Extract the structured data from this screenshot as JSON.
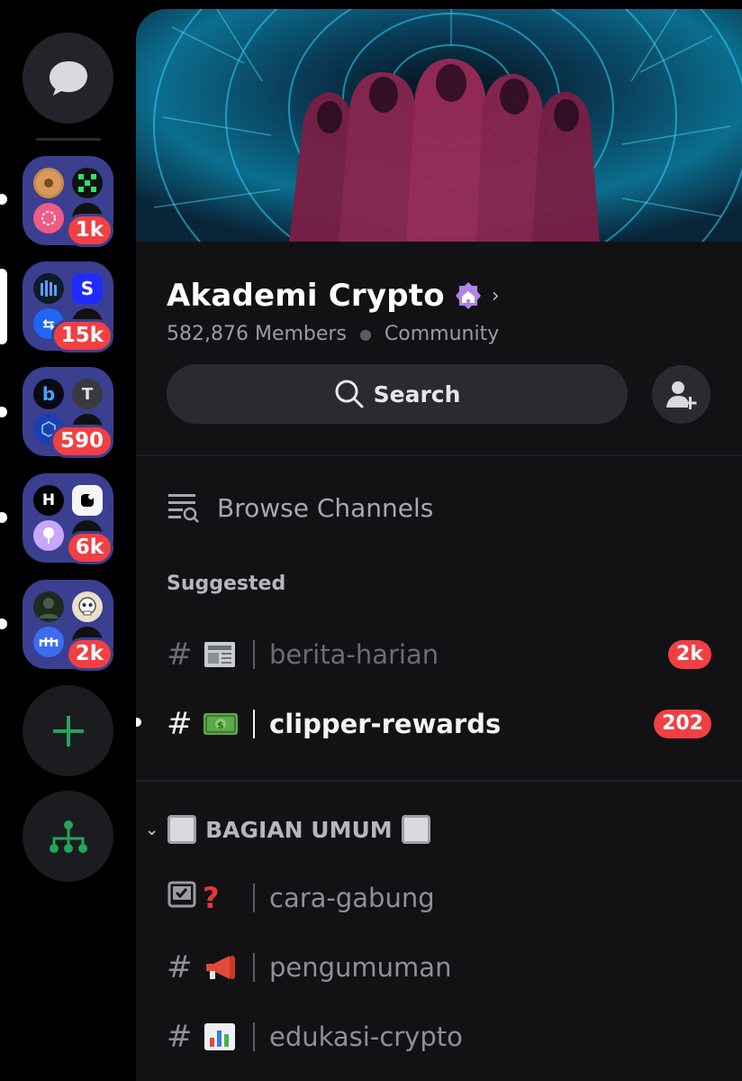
{
  "rail": {
    "dm_icon": "chat-bubble-icon",
    "folders": [
      {
        "badge": "1k",
        "icons": [
          "donut-icon",
          "grid-logo-icon",
          "pink-dots-icon",
          "black-logo-icon"
        ]
      },
      {
        "badge": "15k",
        "icons": [
          "bars-logo-icon",
          "s-logo-icon",
          "swap-logo-icon",
          "dark-logo-icon"
        ],
        "active": true
      },
      {
        "badge": "590",
        "icons": [
          "b-logo-icon",
          "t-logo-icon",
          "cube-logo-icon",
          "dark-logo-icon"
        ]
      },
      {
        "badge": "6k",
        "icons": [
          "h-logo-icon",
          "square-logo-icon",
          "purple-pin-icon",
          "dark-logo-icon"
        ]
      },
      {
        "badge": "2k",
        "icons": [
          "avatar-icon",
          "skull-icon",
          "bridge-logo-icon",
          "dark-logo-icon"
        ]
      }
    ],
    "add_server_icon": "plus-icon",
    "discover_icon": "hierarchy-icon"
  },
  "server": {
    "name": "Akademi Crypto",
    "members": "582,876 Members",
    "type": "Community",
    "badge_icon": "community-home-badge-icon"
  },
  "search": {
    "label": "Search"
  },
  "invite_icon": "add-member-icon",
  "browse_channels": {
    "label": "Browse Channels"
  },
  "suggested": {
    "title": "Suggested",
    "channels": [
      {
        "name": "berita-harian",
        "emoji": "📰",
        "badge": "2k",
        "muted": true
      },
      {
        "name": "clipper-rewards",
        "emoji": "💵",
        "badge": "202",
        "unread": true
      }
    ]
  },
  "category": {
    "title": "BAGIAN UMUM",
    "channels": [
      {
        "name": "cara-gabung",
        "emoji": "❓",
        "icon": "rules-checkbox-icon"
      },
      {
        "name": "pengumuman",
        "emoji": "📣"
      },
      {
        "name": "edukasi-crypto",
        "emoji": "📊"
      }
    ]
  },
  "colors": {
    "accent_badge": "#f23f42",
    "folder_bg": "#3b3f8f",
    "green": "#23a55a",
    "panel_bg": "#121215"
  }
}
